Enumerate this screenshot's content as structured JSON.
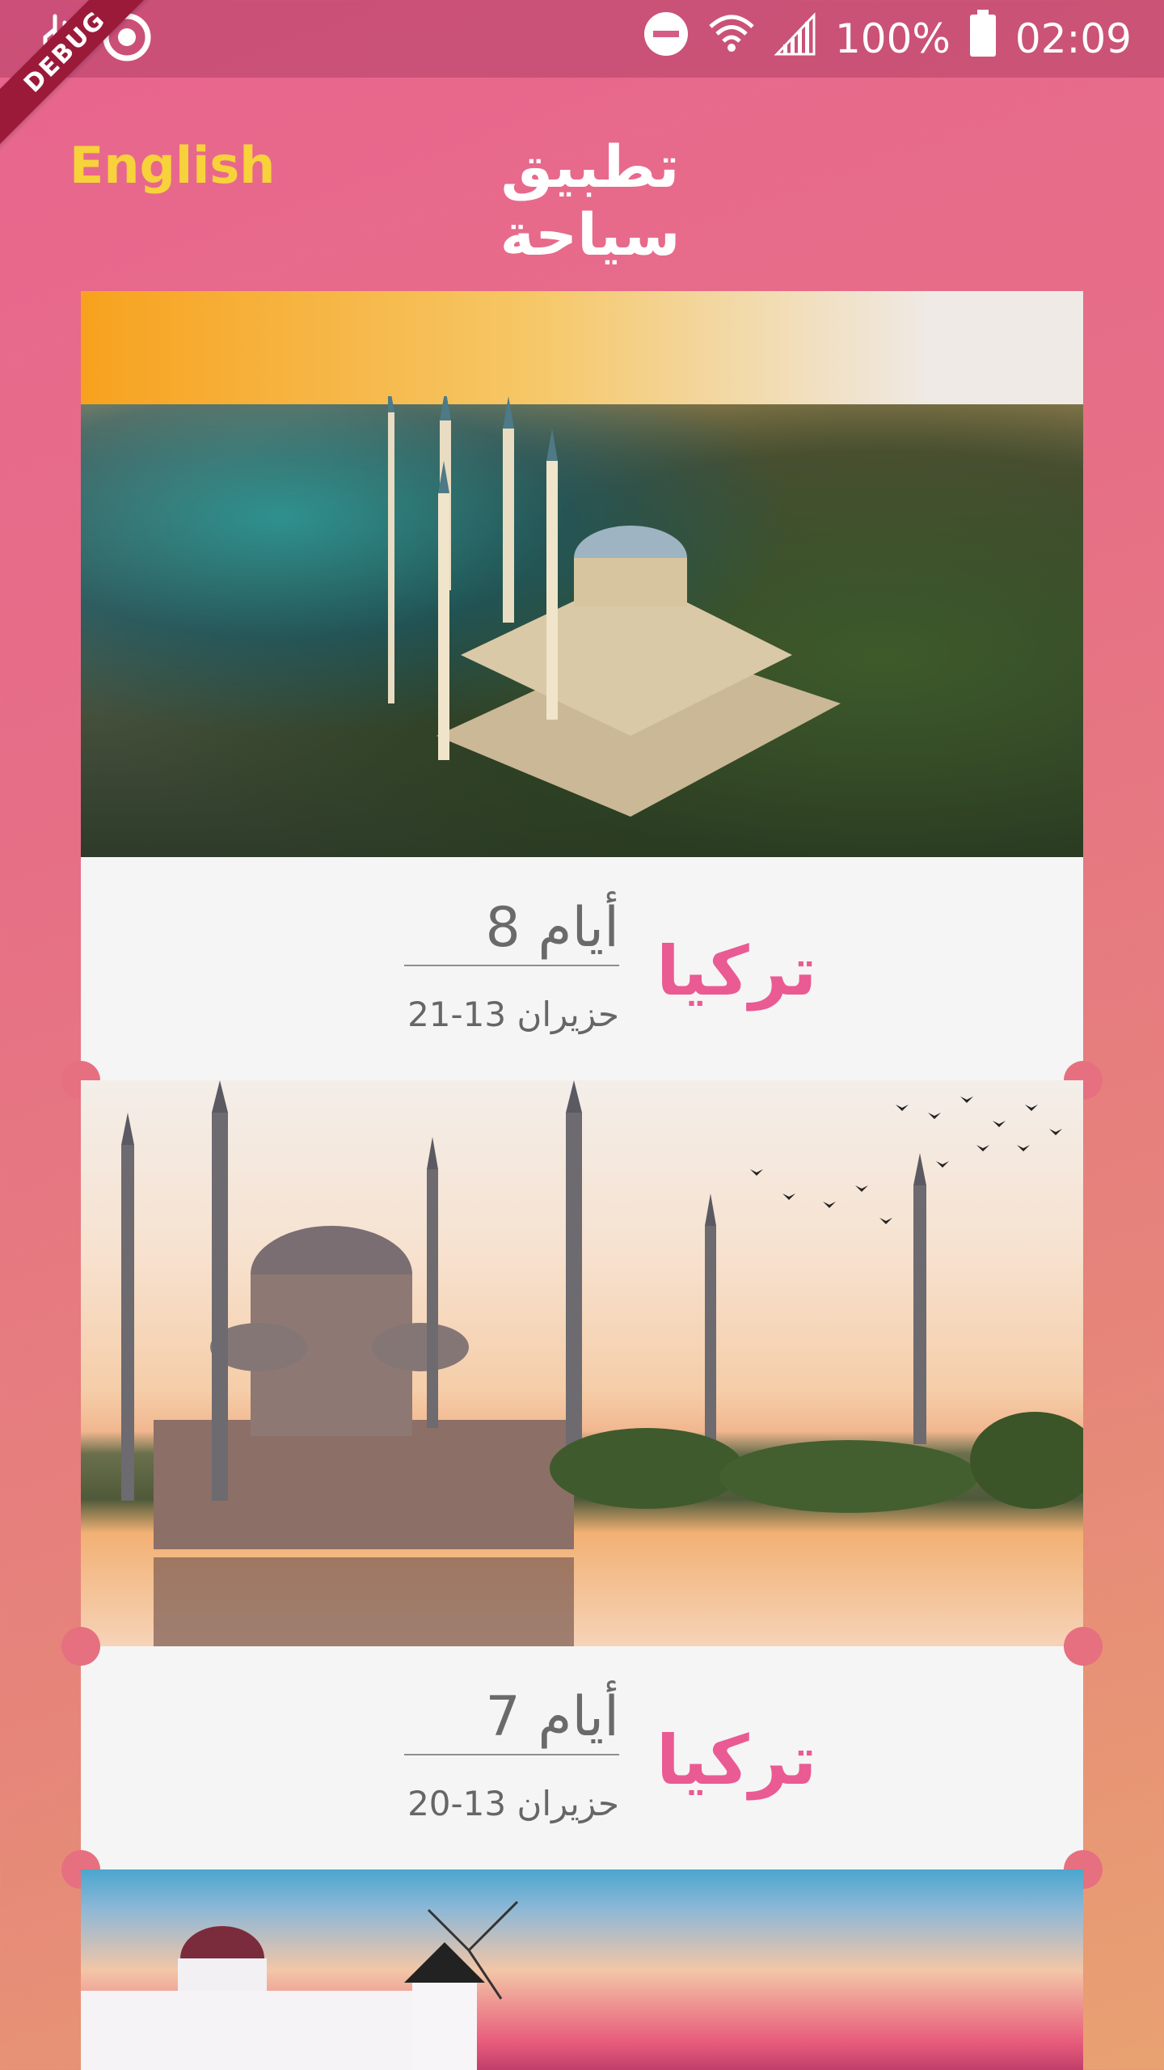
{
  "status_bar": {
    "battery_percent": "100%",
    "time": "02:09",
    "icons": [
      "usb-icon",
      "screen-record-icon",
      "do-not-disturb-icon",
      "wifi-icon",
      "signal-icon",
      "battery-icon"
    ]
  },
  "debug_banner": "DEBUG",
  "app_bar": {
    "language_button": "English",
    "title": "تطبيق سياحة"
  },
  "trips": [
    {
      "destination": "تركيا",
      "duration": "8 أيام",
      "dates": "حزيران 13-21",
      "image": "aerial-mosque-sunset"
    },
    {
      "destination": "تركيا",
      "duration": "7 أيام",
      "dates": "حزيران 13-20",
      "image": "blue-mosque-reflection"
    },
    {
      "image": "santorini-windmill"
    }
  ],
  "colors": {
    "accent": "#ea5a93",
    "language_button": "#f7d23b",
    "card_background": "#f5f5f5"
  }
}
